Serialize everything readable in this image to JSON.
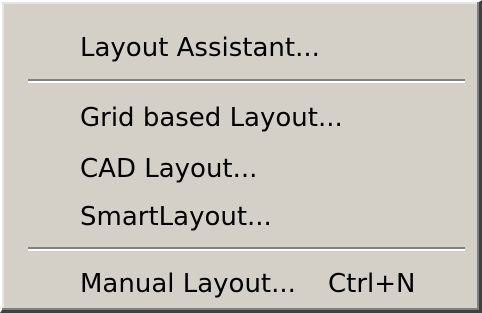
{
  "menu": {
    "items": [
      {
        "label": "Layout Assistant..."
      },
      {
        "label": "Grid based Layout..."
      },
      {
        "label": "CAD Layout..."
      },
      {
        "label": "SmartLayout..."
      },
      {
        "label": "Manual Layout...",
        "shortcut": "Ctrl+N"
      }
    ]
  }
}
